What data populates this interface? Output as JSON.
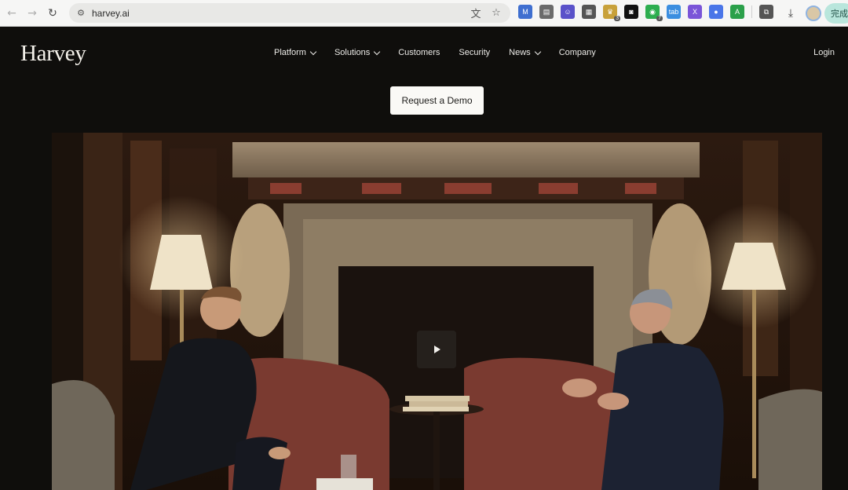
{
  "browser": {
    "url": "harvey.ai",
    "done_label": "完成",
    "extensions": [
      {
        "name": "m-extension-icon",
        "glyph": "M",
        "color": "#3f6fd0"
      },
      {
        "name": "copy-extension-icon",
        "glyph": "▤",
        "color": "#6b6b6b"
      },
      {
        "name": "face-extension-icon",
        "glyph": "☺",
        "color": "#5a52c9"
      },
      {
        "name": "qr-extension-icon",
        "glyph": "▦",
        "color": "#555555"
      },
      {
        "name": "trophy-extension-icon",
        "glyph": "♛",
        "color": "#c8a13a",
        "badge": "3"
      },
      {
        "name": "mask-extension-icon",
        "glyph": "◙",
        "color": "#111111"
      },
      {
        "name": "wechat-extension-icon",
        "glyph": "◉",
        "color": "#2dae4f",
        "badge": "7"
      },
      {
        "name": "tab-extension-icon",
        "glyph": "tab",
        "color": "#3b8ee0"
      },
      {
        "name": "x-extension-icon",
        "glyph": "X",
        "color": "#7a55d8"
      },
      {
        "name": "circle-extension-icon",
        "glyph": "●",
        "color": "#4a76e8"
      },
      {
        "name": "a-extension-icon",
        "glyph": "A",
        "color": "#2ba04a"
      },
      {
        "name": "puzzle-extension-icon",
        "glyph": "⧉",
        "color": "#555555"
      }
    ]
  },
  "site": {
    "logo": "Harvey",
    "nav": [
      {
        "label": "Platform",
        "has_dropdown": true
      },
      {
        "label": "Solutions",
        "has_dropdown": true
      },
      {
        "label": "Customers",
        "has_dropdown": false
      },
      {
        "label": "Security",
        "has_dropdown": false
      },
      {
        "label": "News",
        "has_dropdown": true
      },
      {
        "label": "Company",
        "has_dropdown": false
      }
    ],
    "login_label": "Login",
    "cta_label": "Request a Demo"
  },
  "colors": {
    "page_bg": "#0f0e0c",
    "cta_bg": "#faf9f6",
    "text": "#ecebe8"
  }
}
